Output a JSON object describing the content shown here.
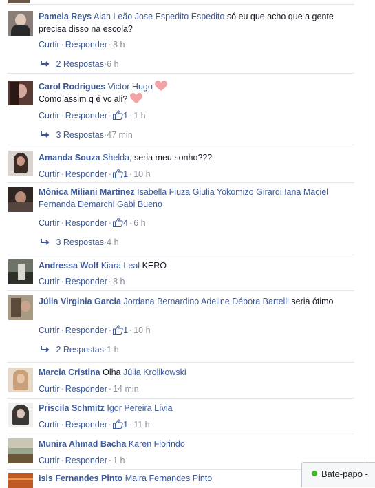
{
  "comments": [
    {
      "author": "Pamela Reys",
      "tags": "Alan Leão Jose Espedito Espedito",
      "text": "só eu que acho que a gente precisa disso na escola?",
      "reply": "Curtir",
      "respond": "Responder",
      "likes": "",
      "time": "8 h",
      "replies": "2 Respostas",
      "replies_time": "6 h",
      "avatar": "#8a7e78"
    },
    {
      "author": "Carol Rodrigues",
      "tags": "Victor Hugo",
      "text": "Como assim q é vc ali?",
      "reply": "Curtir",
      "respond": "Responder",
      "likes": "1",
      "time": "1 h",
      "replies": "3 Respostas",
      "replies_time": "47 min",
      "avatar": "#5a3a35"
    },
    {
      "author": "Amanda Souza",
      "tags": "Shelda,",
      "text": "seria meu sonho???",
      "reply": "Curtir",
      "respond": "Responder",
      "likes": "1",
      "time": "10 h",
      "avatar": "#3c2a25"
    },
    {
      "author": "Mônica Miliani Martinez",
      "tags": "Isabella Fiuza Giulia Yokomizo Girardi Iana Maciel Fernanda Demarchi Gabi Bueno",
      "text": "",
      "reply": "Curtir",
      "respond": "Responder",
      "likes": "4",
      "time": "6 h",
      "replies": "3 Respostas",
      "replies_time": "4 h",
      "avatar": "#2f2724"
    },
    {
      "author": "Andressa Wolf",
      "tags": "Kiara Leal",
      "text": "KERO",
      "reply": "Curtir",
      "respond": "Responder",
      "likes": "",
      "time": "8 h",
      "avatar": "#4b4f48"
    },
    {
      "author": "Júlia Virginia Garcia",
      "tags": "Jordana Bernardino Adeline Débora Bartelli",
      "text": "seria ótimo",
      "reply": "Curtir",
      "respond": "Responder",
      "likes": "1",
      "time": "10 h",
      "replies": "2 Respostas",
      "replies_time": "1 h",
      "avatar": "#6d6456"
    },
    {
      "author": "Marcia Cristina",
      "tags": "",
      "text": "Olha",
      "tags2": "Júlia Krolikowski",
      "reply": "Curtir",
      "respond": "Responder",
      "likes": "",
      "time": "14 min",
      "avatar": "#c9a07a"
    },
    {
      "author": "Priscila Schmitz",
      "tags": "Igor Pereira Lívia",
      "text": "",
      "reply": "Curtir",
      "respond": "Responder",
      "likes": "1",
      "time": "11 h",
      "avatar": "#3a3634"
    },
    {
      "author": "Munira Ahmad Bacha",
      "tags": "Karen Florindo",
      "text": "",
      "reply": "Curtir",
      "respond": "Responder",
      "likes": "",
      "time": "1 h",
      "avatar": "#7d8a74"
    },
    {
      "author": "Isis Fernandes Pinto",
      "tags": "Maira Fernandes Pinto",
      "text": "",
      "avatar": "#c05a25"
    }
  ],
  "chat": {
    "label": "Bate-papo -"
  },
  "colors": {
    "link": "#3b5998",
    "meta": "#898f9c",
    "heart": "#f3a3a6"
  }
}
